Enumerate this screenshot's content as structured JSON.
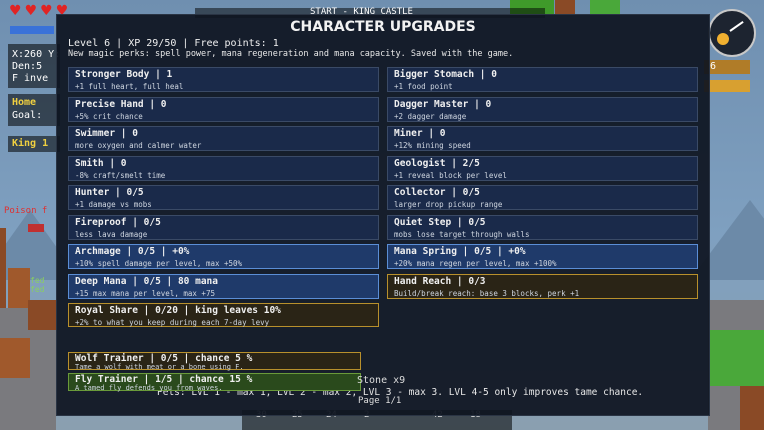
{
  "hud": {
    "hearts_full": 4,
    "coords_line": "X:260 Y:",
    "den_line": "Den:5",
    "inv_line": "F inve",
    "home_label": "Home",
    "goal_label": "Goal:",
    "king_label": "King 1",
    "poison_label": "Poison f",
    "fed_label_1": "fed",
    "fed_label_2": "fed",
    "top_banner": "START - KING CASTLE",
    "side_value": "6",
    "stone_tooltip": "Stone x9",
    "page_label": "Page 1/1",
    "hotbar_counts": [
      "30",
      "25",
      "24",
      "2",
      "42",
      "18"
    ]
  },
  "modal": {
    "title": "CHARACTER UPGRADES",
    "status": "Level 6 | XP 29/50 | Free points: 1",
    "note": "New magic perks: spell power, mana regeneration and mana capacity. Saved with the game.",
    "upgrades_left": [
      {
        "name": "Stronger Body | 1",
        "desc": "+1 full heart, full heal",
        "style": "normal"
      },
      {
        "name": "Precise Hand | 0",
        "desc": "+5% crit chance",
        "style": "normal"
      },
      {
        "name": "Swimmer | 0",
        "desc": "more oxygen and calmer water",
        "style": "normal"
      },
      {
        "name": "Smith | 0",
        "desc": "-8% craft/smelt time",
        "style": "normal"
      },
      {
        "name": "Hunter | 0/5",
        "desc": "+1 damage vs mobs",
        "style": "normal"
      },
      {
        "name": "Fireproof | 0/5",
        "desc": "less lava damage",
        "style": "normal"
      },
      {
        "name": "Archmage | 0/5 | +0%",
        "desc": "+10% spell damage per level, max +50%",
        "style": "highlight"
      },
      {
        "name": "Deep Mana | 0/5 | 80 mana",
        "desc": "+15 max mana per level, max +75",
        "style": "highlight"
      },
      {
        "name": "Royal Share | 0/20 | king leaves 10%",
        "desc": "+2% to what you keep during each 7-day levy",
        "style": "gold"
      }
    ],
    "upgrades_right": [
      {
        "name": "Bigger Stomach | 0",
        "desc": "+1 food point",
        "style": "normal"
      },
      {
        "name": "Dagger Master | 0",
        "desc": "+2 dagger damage",
        "style": "normal"
      },
      {
        "name": "Miner | 0",
        "desc": "+12% mining speed",
        "style": "normal"
      },
      {
        "name": "Geologist | 2/5",
        "desc": "+1 reveal block per level",
        "style": "normal"
      },
      {
        "name": "Collector | 0/5",
        "desc": "larger drop pickup range",
        "style": "normal"
      },
      {
        "name": "Quiet Step | 0/5",
        "desc": "mobs lose target through walls",
        "style": "normal"
      },
      {
        "name": "Mana Spring | 0/5 | +0%",
        "desc": "+20% mana regen per level, max +100%",
        "style": "highlight"
      },
      {
        "name": "Hand Reach | 0/3",
        "desc": "Build/break reach: base 3 blocks, perk +1",
        "style": "gold"
      }
    ],
    "pet_upgrades": [
      {
        "name": "Wolf Trainer | 0/5 | chance 5 %",
        "desc": "Tame a wolf with meat or a bone using F.",
        "style": "gold"
      },
      {
        "name": "Fly Trainer | 1/5 | chance 15 %",
        "desc": "A tamed fly defends you from waves.",
        "style": "green"
      }
    ],
    "pets_note": "Pets: LVL 1 - max 1, LVL 2 - max 2, LVL 3 - max 3. LVL 4-5 only improves tame chance."
  },
  "colors": {
    "card_normal": "#1a2a4a",
    "card_highlight": "#1f3a6a",
    "card_gold_border": "#b8902c",
    "heart": "#e02424"
  }
}
